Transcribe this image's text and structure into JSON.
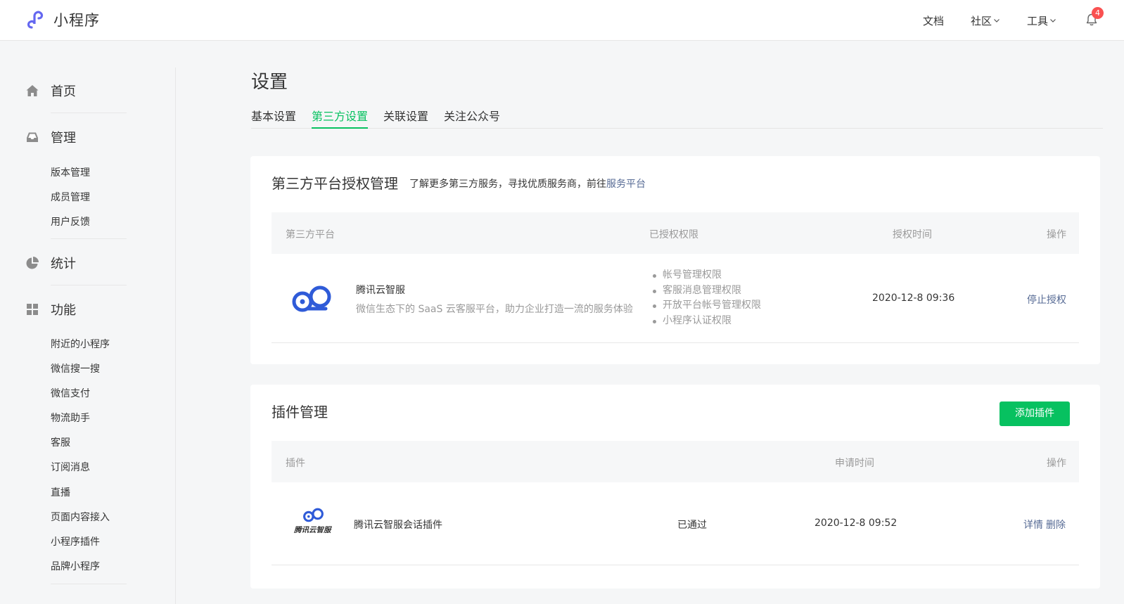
{
  "header": {
    "logo_text": "小程序",
    "nav": [
      {
        "label": "文档",
        "dropdown": false
      },
      {
        "label": "社区",
        "dropdown": true
      },
      {
        "label": "工具",
        "dropdown": true
      }
    ],
    "notification_count": "4"
  },
  "sidebar": {
    "groups": [
      {
        "label": "首页",
        "icon": "home-icon"
      },
      {
        "label": "管理",
        "icon": "inbox-icon",
        "items": [
          "版本管理",
          "成员管理",
          "用户反馈"
        ]
      },
      {
        "label": "统计",
        "icon": "pie-chart-icon"
      },
      {
        "label": "功能",
        "icon": "grid-icon",
        "items": [
          "附近的小程序",
          "微信搜一搜",
          "微信支付",
          "物流助手",
          "客服",
          "订阅消息",
          "直播",
          "页面内容接入",
          "小程序插件",
          "品牌小程序"
        ]
      }
    ]
  },
  "main": {
    "title": "设置",
    "tabs": [
      {
        "label": "基本设置",
        "active": false
      },
      {
        "label": "第三方设置",
        "active": true
      },
      {
        "label": "关联设置",
        "active": false
      },
      {
        "label": "关注公众号",
        "active": false
      }
    ],
    "third_party": {
      "title": "第三方平台授权管理",
      "desc": "了解更多第三方服务，寻找优质服务商，前往",
      "desc_link": "服务平台",
      "columns": [
        "第三方平台",
        "已授权权限",
        "授权时间",
        "操作"
      ],
      "rows": [
        {
          "name": "腾讯云智服",
          "desc": "微信生态下的 SaaS 云客服平台，助力企业打造一流的服务体验",
          "permissions": [
            "帐号管理权限",
            "客服消息管理权限",
            "开放平台帐号管理权限",
            "小程序认证权限"
          ],
          "time": "2020-12-8 09:36",
          "action": "停止授权"
        }
      ]
    },
    "plugins": {
      "title": "插件管理",
      "add_button": "添加插件",
      "columns": [
        "插件",
        "申请时间",
        "操作"
      ],
      "rows": [
        {
          "logo_text": "腾讯云智服",
          "name": "腾讯云智服会话插件",
          "status": "已通过",
          "time": "2020-12-8 09:52",
          "actions": [
            "详情",
            "删除"
          ]
        }
      ]
    }
  },
  "colors": {
    "accent": "#07c160",
    "link": "#576b95",
    "badge": "#fa5151",
    "brand_blue": "#2f5bd8"
  }
}
